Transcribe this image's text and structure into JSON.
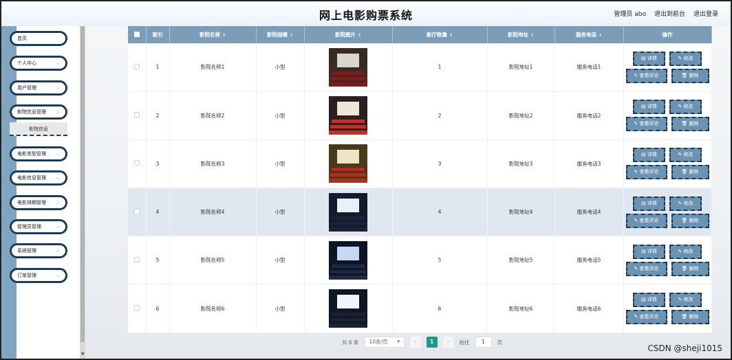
{
  "header": {
    "title": "网上电影购票系统",
    "user": "管理员 abo",
    "frontend_link": "退出到前台",
    "logout_link": "退出登录"
  },
  "sidebar": {
    "items": [
      {
        "label": "首页",
        "has_arrow": false
      },
      {
        "label": "个人中心",
        "has_arrow": true
      },
      {
        "label": "用户管理",
        "has_arrow": true
      },
      {
        "label": "影院信息管理",
        "has_arrow": true
      },
      {
        "label": "电影类型管理",
        "has_arrow": true
      },
      {
        "label": "电影信息管理",
        "has_arrow": true
      },
      {
        "label": "电影排期管理",
        "has_arrow": true
      },
      {
        "label": "管理员管理",
        "has_arrow": true
      },
      {
        "label": "系统管理",
        "has_arrow": true
      },
      {
        "label": "订单管理",
        "has_arrow": true
      }
    ],
    "submenu_label": "影院信息"
  },
  "table": {
    "columns": [
      "索引",
      "影院名称",
      "影院规模",
      "影院图片",
      "影厅数量",
      "影院地址",
      "服务电话",
      "操作"
    ],
    "rows": [
      {
        "index": "1",
        "name": "影院名称1",
        "size": "小型",
        "halls": "1",
        "address": "影院地址1",
        "phone": "服务电话1",
        "image_icon": "cinema-image-icon"
      },
      {
        "index": "2",
        "name": "影院名称2",
        "size": "小型",
        "halls": "2",
        "address": "影院地址2",
        "phone": "服务电话2",
        "image_icon": "cinema-image-icon"
      },
      {
        "index": "3",
        "name": "影院名称3",
        "size": "小型",
        "halls": "3",
        "address": "影院地址3",
        "phone": "服务电话3",
        "image_icon": "cinema-image-icon"
      },
      {
        "index": "4",
        "name": "影院名称4",
        "size": "小型",
        "halls": "4",
        "address": "影院地址4",
        "phone": "服务电话4",
        "image_icon": "cinema-image-icon"
      },
      {
        "index": "5",
        "name": "影院名称5",
        "size": "小型",
        "halls": "5",
        "address": "影院地址5",
        "phone": "服务电话5",
        "image_icon": "cinema-image-icon"
      },
      {
        "index": "6",
        "name": "影院名称6",
        "size": "小型",
        "halls": "6",
        "address": "影院地址6",
        "phone": "服务电话6",
        "image_icon": "cinema-image-icon"
      }
    ],
    "actions": {
      "detail": "详情",
      "edit": "修改",
      "review": "查看评论",
      "delete": "删除"
    }
  },
  "pagination": {
    "total": "共 6 条",
    "page_size": "10条/页",
    "current_page": "1",
    "goto_label": "前往",
    "goto_value": "1",
    "page_suffix": "页"
  },
  "watermark": "CSDN @sheji1015",
  "colors": {
    "header_bg": "#7c9db8",
    "accent": "#1d9b8a",
    "sidebar_strip": "#7fa5bf",
    "button_bg": "#6d93b2",
    "border_dark": "#1e3a56"
  }
}
